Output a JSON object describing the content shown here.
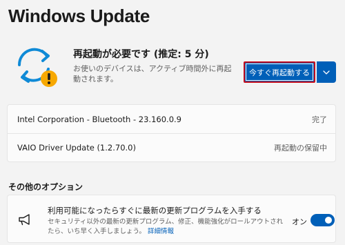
{
  "page": {
    "title": "Windows Update"
  },
  "status": {
    "title": "再起動が必要です (推定: 5 分)",
    "subtitle": "お使いのデバイスは、アクティブ時間外に再起動されます。",
    "restart_button": "今すぐ再起動する",
    "icon": "sync-arrows-warning-icon"
  },
  "updates": [
    {
      "name": "Intel Corporation - Bluetooth - 23.160.0.9",
      "status": "完了"
    },
    {
      "name": "VAIO Driver Update (1.2.70.0)",
      "status": "再起動の保留中"
    }
  ],
  "options": {
    "heading": "その他のオプション",
    "item": {
      "icon": "megaphone-icon",
      "title": "利用可能になったらすぐに最新の更新プログラムを入手する",
      "description": "セキュリティ以外の最新の更新プログラム、修正、機能強化がロールアウトされたら、いち早く入手しましょう。",
      "link": "詳細情報",
      "toggle_label": "オン",
      "toggle_on": true
    }
  },
  "colors": {
    "accent": "#005fb8",
    "highlight_border": "#c50f1f",
    "warning": "#f7a800"
  }
}
